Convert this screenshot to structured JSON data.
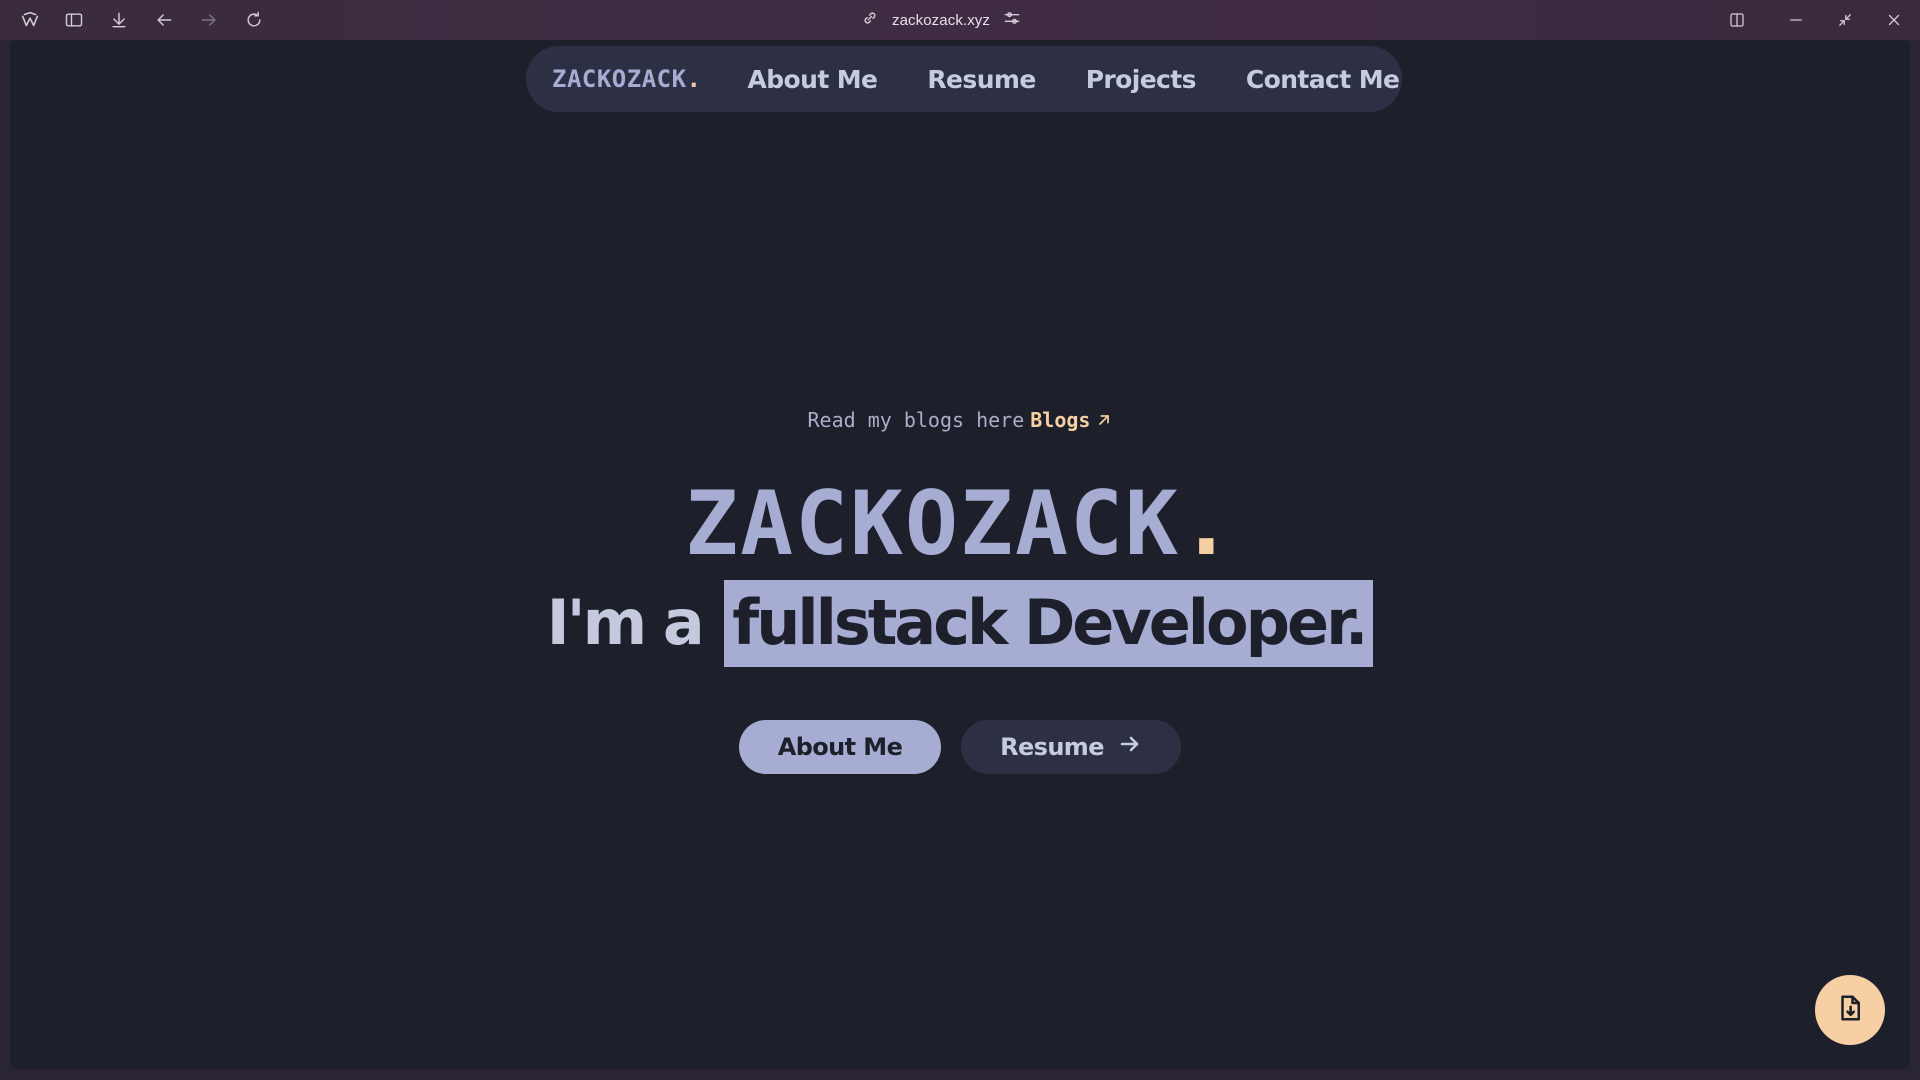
{
  "browser": {
    "url": "zackozack.xyz",
    "icons": {
      "app": "browser-logo-icon",
      "sidebar": "sidebar-toggle-icon",
      "downloads": "download-icon",
      "back": "arrow-left-icon",
      "forward": "arrow-right-icon",
      "reload": "reload-icon",
      "link": "link-icon",
      "site_settings": "sliders-icon",
      "split": "split-view-icon",
      "minimize": "minimize-icon",
      "restore": "restore-icon",
      "close": "close-icon"
    }
  },
  "nav": {
    "brand": "ZACKOZACK",
    "brand_dot": ".",
    "links": [
      "About Me",
      "Resume",
      "Projects",
      "Contact Me"
    ]
  },
  "hero": {
    "blog_prompt": "Read my blogs here",
    "blog_link": "Blogs",
    "title": "ZACKOZACK",
    "title_dot": ".",
    "subtitle_prefix": "I'm a",
    "subtitle_highlight": "fullstack Developer."
  },
  "buttons": {
    "primary": "About Me",
    "secondary": "Resume"
  },
  "fab": {
    "icon": "file-download-icon"
  },
  "colors": {
    "background": "#1d1f2b",
    "nav_bg": "#2d3044",
    "accent_lavender": "#a6acd2",
    "accent_peach": "#f6cfa3",
    "text_light": "#c7cbe2"
  }
}
